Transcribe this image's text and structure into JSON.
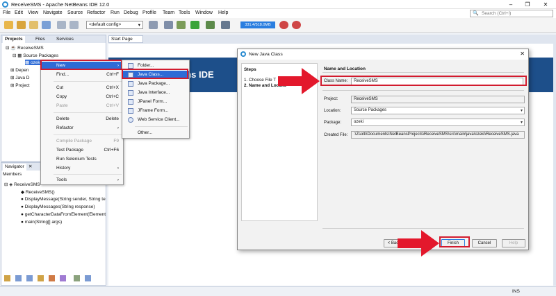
{
  "window": {
    "title": "ReceiveSMS - Apache NetBeans IDE 12.0",
    "controls": [
      "–",
      "❐",
      "✕"
    ]
  },
  "menu": [
    "File",
    "Edit",
    "View",
    "Navigate",
    "Source",
    "Refactor",
    "Run",
    "Debug",
    "Profile",
    "Team",
    "Tools",
    "Window",
    "Help"
  ],
  "search": {
    "placeholder": "Search (Ctrl+I)"
  },
  "toolbar": {
    "config": "<default config>",
    "memory": "331.4/518.0MB"
  },
  "projects_panel": {
    "tabs": [
      "Projects",
      "Files",
      "Services"
    ],
    "tree": [
      "ReceiveSMS",
      "Source Packages",
      "ozeki",
      "Depen",
      "Java D",
      "Project"
    ]
  },
  "context_menu": {
    "items": [
      {
        "label": "New",
        "shortcut": "›"
      },
      {
        "label": "Find...",
        "shortcut": "Ctrl+F"
      },
      {
        "label": "Cut",
        "shortcut": "Ctrl+X"
      },
      {
        "label": "Copy",
        "shortcut": "Ctrl+C"
      },
      {
        "label": "Paste",
        "shortcut": "Ctrl+V"
      },
      {
        "label": "Delete",
        "shortcut": "Delete"
      },
      {
        "label": "Refactor",
        "shortcut": "›"
      },
      {
        "label": "Compile Package",
        "shortcut": "F9"
      },
      {
        "label": "Test Package",
        "shortcut": "Ctrl+F6"
      },
      {
        "label": "Run Selenium Tests",
        "shortcut": ""
      },
      {
        "label": "History",
        "shortcut": "›"
      },
      {
        "label": "Tools",
        "shortcut": "›"
      }
    ]
  },
  "submenu": {
    "items": [
      "Folder...",
      "Java Class...",
      "Java Package...",
      "Java Interface...",
      "JPanel Form...",
      "JFrame Form...",
      "Web Service Client...",
      "Other..."
    ]
  },
  "editor": {
    "tab": "Start Page",
    "banner": "ans IDE"
  },
  "navigator": {
    "title": "Navigator",
    "members_label": "Members",
    "items": [
      "ReceiveSMS",
      "ReceiveSMS()",
      "DisplayMessage(String sender, String te",
      "DisplayMessages(String response)",
      "getCharacterDataFromElement(Element",
      "main(String[] args)"
    ],
    "close": "✕"
  },
  "dialog": {
    "title": "New Java Class",
    "steps_heading": "Steps",
    "steps": [
      "1.   Choose File T",
      "2.   Name and Locatio"
    ],
    "section": "Name and Location",
    "class_name_label": "Class Name:",
    "class_name_value": "ReceiveSMS",
    "project_label": "Project:",
    "project_value": "ReceiveSMS",
    "location_label": "Location:",
    "location_value": "Source Packages",
    "package_label": "Package:",
    "package_value": "ozeki",
    "created_label": "Created File:",
    "created_value": ":\\Zsolti\\Documents\\NetBeansProjects\\ReceiveSMS\\src\\main\\java\\ozeki\\ReceiveSMS.java",
    "buttons": {
      "back": "< Back",
      "finish": "Finish",
      "cancel": "Cancel",
      "help": "Help"
    }
  },
  "status": {
    "mode": "INS"
  },
  "colors": {
    "accent": "#2e6bd6",
    "annotation_red": "#e3182c",
    "banner": "#1d4f8a"
  }
}
